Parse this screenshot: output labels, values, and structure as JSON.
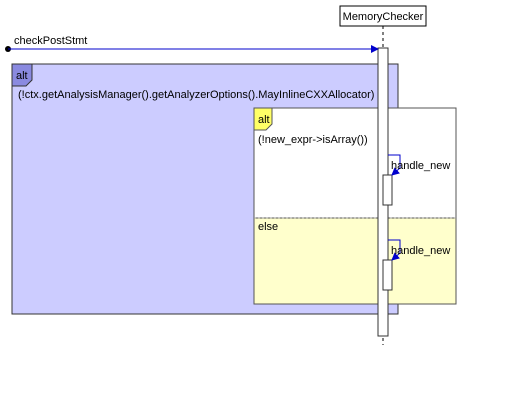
{
  "lifeline": {
    "name": "MemoryChecker"
  },
  "found_message": {
    "label": "checkPostStmt"
  },
  "outer_fragment": {
    "operator": "alt",
    "guard": "(!ctx.getAnalysisManager().getAnalyzerOptions().MayInlineCXXAllocator)"
  },
  "inner_fragment": {
    "operator": "alt",
    "guard": "(!new_expr->isArray())",
    "else_label": "else"
  },
  "self_calls": [
    {
      "label": "handle_new"
    },
    {
      "label": "handle_new"
    }
  ],
  "colors": {
    "outer_fill": "#ccccff",
    "outer_tab": "#8a8ae0",
    "inner_tab": "#ffff66",
    "else_fill": "#ffffcc",
    "message_line": "#0000cc"
  }
}
